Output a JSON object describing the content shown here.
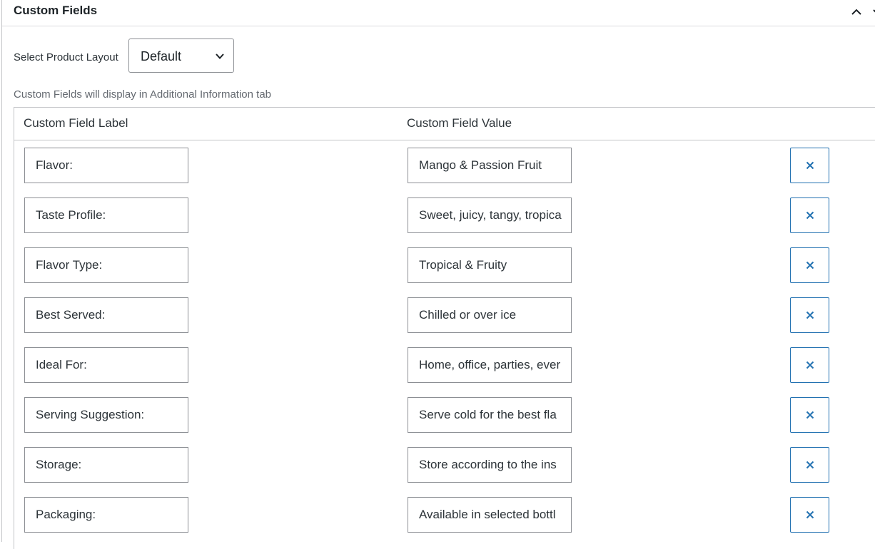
{
  "panel": {
    "title": "Custom Fields"
  },
  "layout": {
    "label": "Select Product Layout",
    "selected": "Default"
  },
  "hint": "Custom Fields will display in Additional Information tab",
  "table": {
    "col_label": "Custom Field Label",
    "col_value": "Custom Field Value",
    "rows": [
      {
        "label": "Flavor:",
        "value": "Mango & Passion Fruit"
      },
      {
        "label": "Taste Profile:",
        "value": "Sweet, juicy, tangy, tropica"
      },
      {
        "label": "Flavor Type:",
        "value": "Tropical & Fruity"
      },
      {
        "label": "Best Served:",
        "value": "Chilled or over ice"
      },
      {
        "label": "Ideal For:",
        "value": "Home, office, parties, ever"
      },
      {
        "label": "Serving Suggestion:",
        "value": "Serve cold for the best fla"
      },
      {
        "label": "Storage:",
        "value": "Store according to the ins"
      },
      {
        "label": "Packaging:",
        "value": "Available in selected bottl"
      }
    ]
  },
  "icons": {
    "collapse": "chevron-up-icon",
    "remove": "close-icon",
    "select": "chevron-down-icon"
  },
  "colors": {
    "accent": "#2271b1",
    "border": "#8c8f94"
  }
}
